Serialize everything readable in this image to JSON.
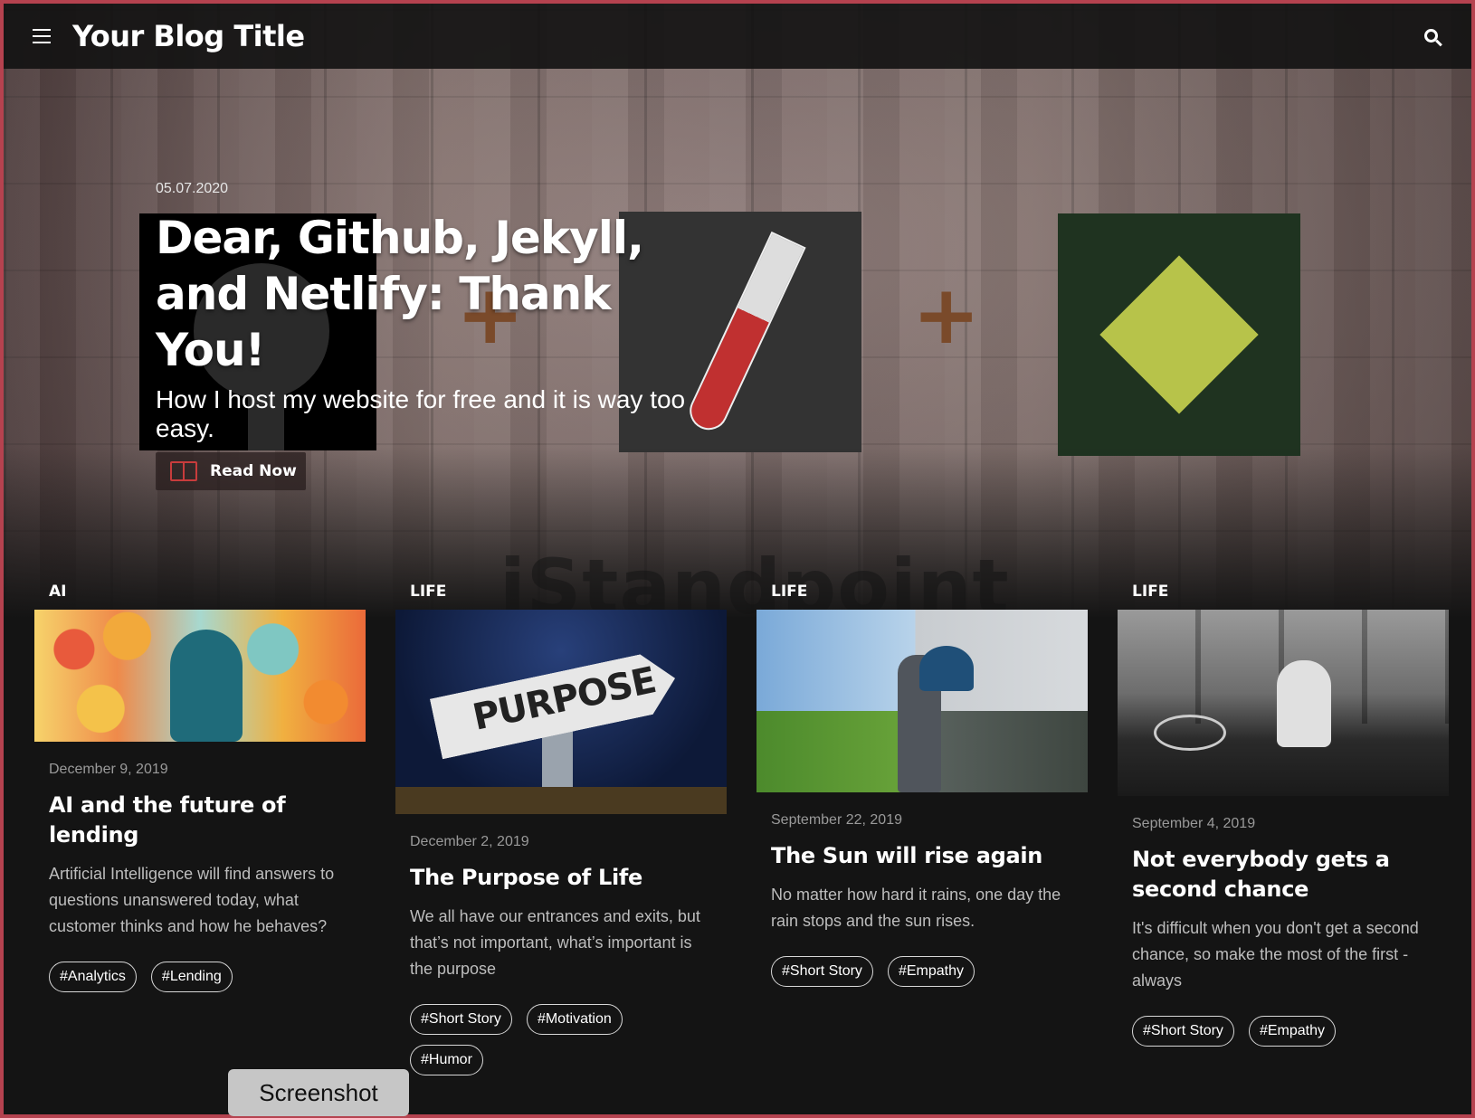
{
  "nav": {
    "brand": "Your Blog Title",
    "menu_icon": "hamburger-menu-icon",
    "search_icon": "search-icon"
  },
  "hero": {
    "date": "05.07.2020",
    "title": "Dear, Github, Jekyll, and Netlify: Thank You!",
    "subtitle": "How I host my website for free and it is way too easy.",
    "cta_label": "Read Now",
    "cta_icon": "book-icon",
    "watermark": "iStandpoint"
  },
  "posts": [
    {
      "category": "AI",
      "date": "December 9, 2019",
      "title": "AI and the future of lending",
      "excerpt": "Artificial Intelligence will find answers to questions unanswered today, what customer thinks and how he behaves?",
      "tags": [
        "#Analytics",
        "#Lending"
      ]
    },
    {
      "category": "LIFE",
      "date": "December 2, 2019",
      "title": "The Purpose of Life",
      "excerpt": "We all have our entrances and exits, but that’s not important, what’s important is the purpose",
      "image_text": "PURPOSE",
      "tags": [
        "#Short Story",
        "#Motivation",
        "#Humor"
      ]
    },
    {
      "category": "LIFE",
      "date": "September 22, 2019",
      "title": "The Sun will rise again",
      "excerpt": "No matter how hard it rains, one day the rain stops and the sun rises.",
      "tags": [
        "#Short Story",
        "#Empathy"
      ]
    },
    {
      "category": "LIFE",
      "date": "September 4, 2019",
      "title": "Not everybody gets a second chance",
      "excerpt": "It's difficult when you don't get a second chance, so make the most of the first - always",
      "tags": [
        "#Short Story",
        "#Empathy"
      ]
    }
  ],
  "overlay": {
    "tooltip": "Screenshot"
  },
  "colors": {
    "accent_border": "#b5424f",
    "background": "#141414",
    "book_icon": "#c83c3c"
  }
}
